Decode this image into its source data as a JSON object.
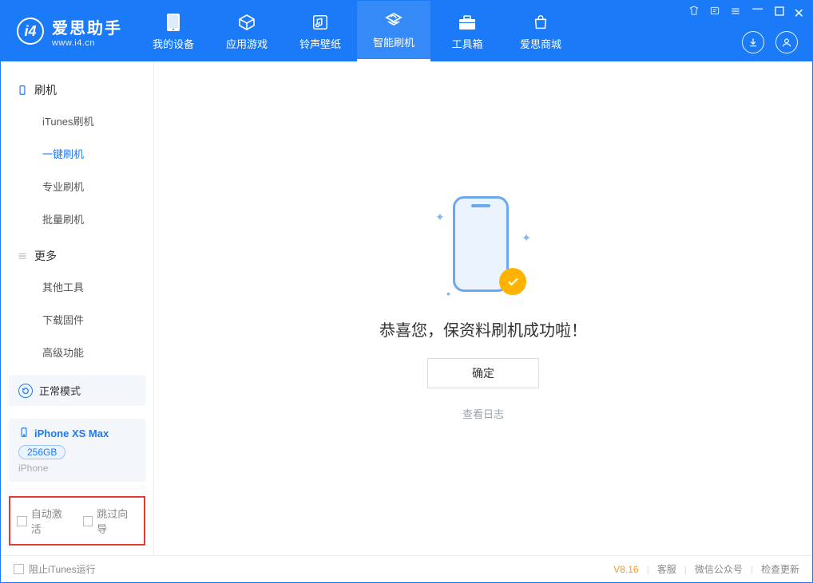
{
  "app": {
    "name_zh": "爱思助手",
    "name_en": "www.i4.cn"
  },
  "window_controls": [
    "shirt-icon",
    "list-icon",
    "menu-icon",
    "min",
    "max",
    "close"
  ],
  "nav": [
    {
      "id": "device",
      "label": "我的设备",
      "icon": "phone-icon",
      "active": false
    },
    {
      "id": "apps",
      "label": "应用游戏",
      "icon": "cube-icon",
      "active": false
    },
    {
      "id": "ring",
      "label": "铃声壁纸",
      "icon": "music-icon",
      "active": false
    },
    {
      "id": "flash",
      "label": "智能刷机",
      "icon": "refresh-icon",
      "active": true
    },
    {
      "id": "tools",
      "label": "工具箱",
      "icon": "toolbox-icon",
      "active": false
    },
    {
      "id": "store",
      "label": "爱思商城",
      "icon": "bag-icon",
      "active": false
    }
  ],
  "top_right_buttons": [
    "download-icon",
    "user-icon"
  ],
  "sidebar": {
    "sections": [
      {
        "id": "flash",
        "title": "刷机",
        "icon": "device-outline-icon",
        "items": [
          {
            "id": "itunes",
            "label": "iTunes刷机",
            "active": false
          },
          {
            "id": "onekey",
            "label": "一键刷机",
            "active": true
          },
          {
            "id": "pro",
            "label": "专业刷机",
            "active": false
          },
          {
            "id": "batch",
            "label": "批量刷机",
            "active": false
          }
        ]
      },
      {
        "id": "more",
        "title": "更多",
        "icon": "hamburger-icon",
        "items": [
          {
            "id": "other",
            "label": "其他工具",
            "active": false
          },
          {
            "id": "firmware",
            "label": "下载固件",
            "active": false
          },
          {
            "id": "adv",
            "label": "高级功能",
            "active": false
          }
        ]
      }
    ],
    "mode": {
      "icon": "normal-mode-icon",
      "label": "正常模式"
    },
    "device": {
      "icon": "phone-small-icon",
      "name": "iPhone XS Max",
      "capacity": "256GB",
      "type": "iPhone"
    },
    "checks": [
      {
        "id": "auto_activate",
        "label": "自动激活",
        "checked": false
      },
      {
        "id": "skip_guide",
        "label": "跳过向导",
        "checked": false
      }
    ]
  },
  "main": {
    "message": "恭喜您，保资料刷机成功啦！",
    "ok": "确定",
    "view_log": "查看日志"
  },
  "footer": {
    "block_itunes": "阻止iTunes运行",
    "version": "V8.16",
    "links": [
      "客服",
      "微信公众号",
      "检查更新"
    ]
  },
  "colors": {
    "primary": "#1b7af7",
    "accent": "#ffb300",
    "highlight_border": "#e53935",
    "version": "#f89a1c"
  }
}
